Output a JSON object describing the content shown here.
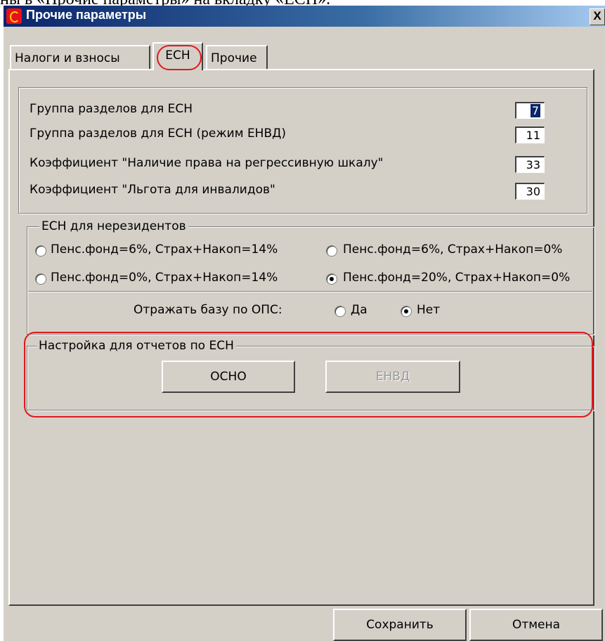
{
  "document": {
    "heading_fragment": "ны в «Прочие параметры» на вкладку «ЕСН»."
  },
  "window": {
    "title": "Прочие параметры",
    "close_label": "X"
  },
  "tabs": [
    {
      "label": "Налоги и взносы"
    },
    {
      "label": "ЕСН",
      "active": true
    },
    {
      "label": "Прочие"
    }
  ],
  "groups": {
    "fields": [
      {
        "label": "Группа разделов для ЕСН",
        "value": "7"
      },
      {
        "label": "Группа разделов для ЕСН (режим ЕНВД)",
        "value": "11"
      },
      {
        "label": "Коэффициент \"Наличие права на регрессивную шкалу\"",
        "value": "33"
      },
      {
        "label": "Коэффициент \"Льгота для инвалидов\"",
        "value": "30"
      }
    ],
    "nonresident": {
      "title": "ЕСН для нерезидентов",
      "options": [
        {
          "label": "Пенс.фонд=6%, Страх+Накоп=14%",
          "checked": false
        },
        {
          "label": "Пенс.фонд=6%, Страх+Накоп=0%",
          "checked": false
        },
        {
          "label": "Пенс.фонд=0%, Страх+Накоп=14%",
          "checked": false
        },
        {
          "label": "Пенс.фонд=20%, Страх+Накоп=0%",
          "checked": true
        }
      ]
    },
    "ops": {
      "label": "Отражать базу по  ОПС:",
      "yes": "Да",
      "no": "Нет",
      "selected": "no"
    },
    "reports": {
      "title": "Настройка для отчетов по  ЕСН",
      "osno": "ОСНО",
      "envd": "ЕНВД"
    }
  },
  "footer": {
    "save": "Сохранить",
    "cancel": "Отмена"
  },
  "colors": {
    "face": "#d4d0c8",
    "titlebar": "#0a246a",
    "highlight_ring": "#e0191f",
    "selection": "#0a246a"
  }
}
